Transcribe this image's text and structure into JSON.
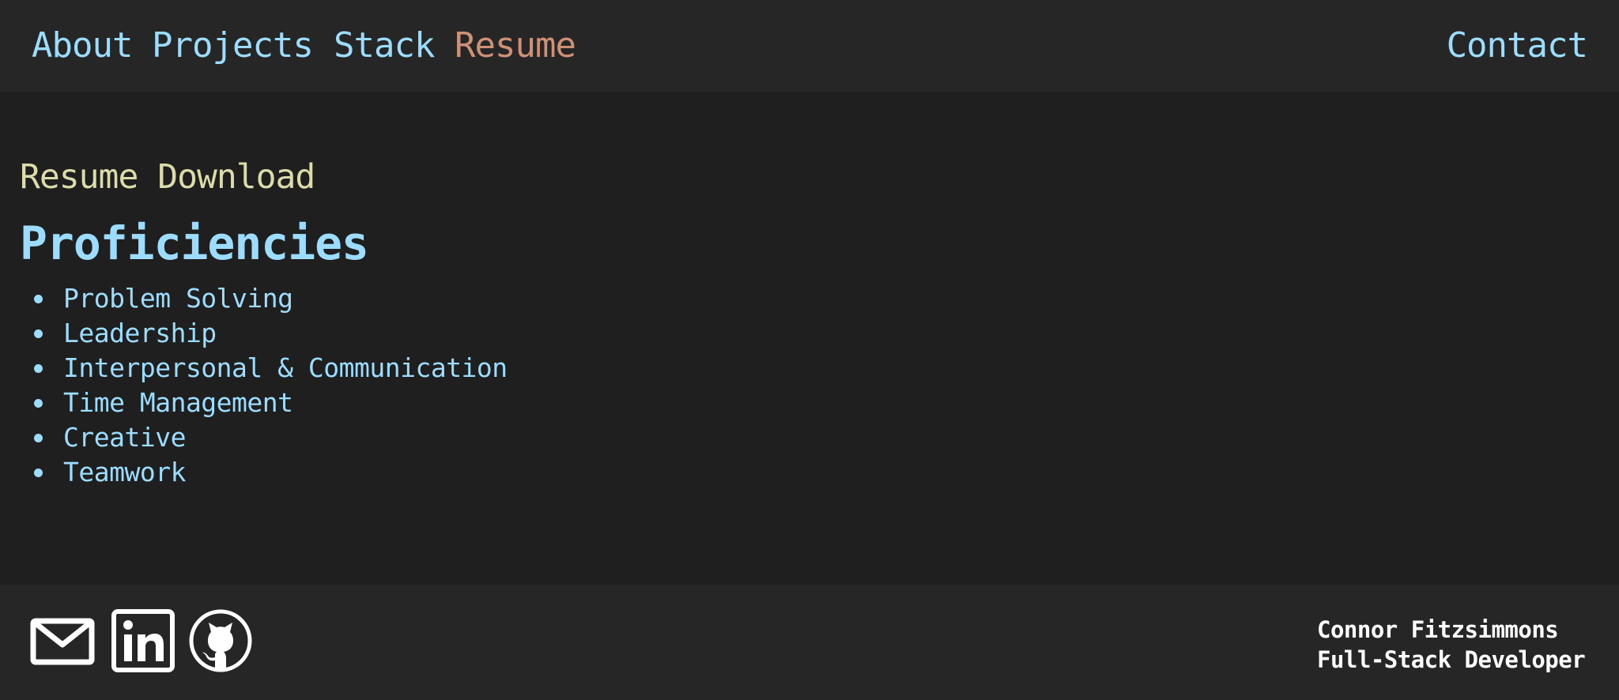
{
  "nav": {
    "items": [
      {
        "label": "About",
        "active": false
      },
      {
        "label": "Projects",
        "active": false
      },
      {
        "label": "Stack",
        "active": false
      },
      {
        "label": "Resume",
        "active": true
      }
    ],
    "contact_label": "Contact"
  },
  "main": {
    "download_label": "Resume Download",
    "heading": "Proficiencies",
    "proficiencies": [
      "Problem Solving",
      "Leadership",
      "Interpersonal & Communication",
      "Time Management",
      "Creative",
      "Teamwork"
    ]
  },
  "footer": {
    "icons": [
      "mail-icon",
      "linkedin-icon",
      "github-icon"
    ],
    "name": "Connor Fitzsimmons",
    "role": "Full-Stack Developer"
  },
  "colors": {
    "background": "#1f1f1f",
    "bars": "#262626",
    "link": "#9cdcfe",
    "active_link": "#ce9178",
    "download": "#dcdcaa",
    "footer_text": "#ffffff"
  }
}
